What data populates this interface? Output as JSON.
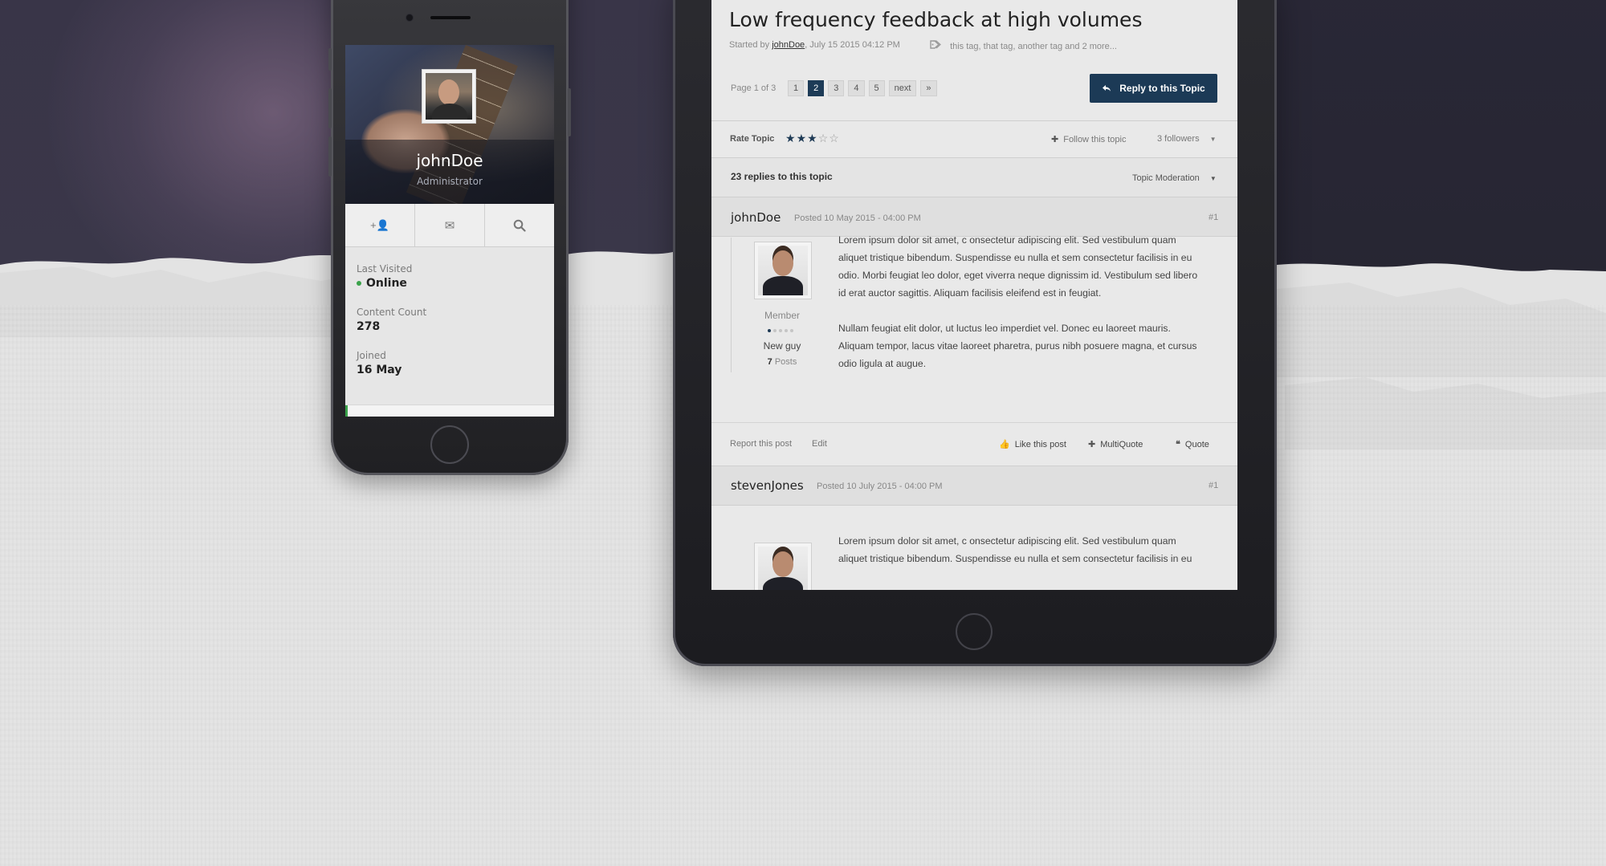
{
  "phone": {
    "profile": {
      "username": "johnDoe",
      "role": "Administrator",
      "actions": [
        {
          "icon": "add-user-icon",
          "glyph": "+👤"
        },
        {
          "icon": "envelope-icon",
          "glyph": "✉"
        },
        {
          "icon": "search-icon",
          "glyph": "⌕"
        }
      ],
      "stats": {
        "last_visited_label": "Last Visited",
        "last_visited_value": "Online",
        "content_count_label": "Content Count",
        "content_count_value": "278",
        "joined_label": "Joined",
        "joined_value": "16 May"
      }
    }
  },
  "topic": {
    "title": "Low frequency feedback at high volumes",
    "started_by_prefix": "Started by ",
    "author": "johnDoe",
    "started_date": ", July 15 2015 04:12 PM",
    "tags": "this tag, that tag, another tag and 2 more...",
    "pagination": {
      "label": "Page 1 of 3",
      "pages": [
        "1",
        "2",
        "3",
        "4",
        "5"
      ],
      "active_page": "2",
      "next_label": "next",
      "last_label": "»"
    },
    "reply_button": "Reply to this Topic",
    "rate_label": "Rate Topic",
    "rating": 3,
    "rating_max": 5,
    "follow_label": "Follow this topic",
    "followers_label": "3 followers",
    "replies_label": "23 replies to this topic",
    "moderation_label": "Topic Moderation"
  },
  "posts": [
    {
      "author": "johnDoe",
      "date": "Posted 10 May 2015 - 04:00 PM",
      "number": "#1",
      "member_group": "Member",
      "rank_level": 1,
      "rank_max": 5,
      "rank_title": "New guy",
      "post_count": "7",
      "post_count_suffix": " Posts",
      "paragraphs": [
        "Lorem ipsum dolor sit amet, c onsectetur adipiscing elit. Sed vestibulum quam aliquet tristique bibendum. Suspendisse eu nulla et sem consectetur facilisis in eu odio. Morbi feugiat leo dolor, eget viverra neque dignissim id. Vestibulum sed libero id erat auctor sagittis. Aliquam facilisis eleifend est in feugiat.",
        "Nullam feugiat elit dolor, ut luctus leo imperdiet vel. Donec eu laoreet mauris. Aliquam tempor, lacus vitae laoreet pharetra, purus nibh posuere magna, et cursus odio ligula at augue."
      ],
      "footer": {
        "report": "Report this post",
        "edit": "Edit",
        "like": "Like this post",
        "multiquote": "MultiQuote",
        "quote": "Quote"
      }
    },
    {
      "author": "stevenJones",
      "date": "Posted 10 July 2015 - 04:00 PM",
      "number": "#1",
      "paragraphs": [
        "Lorem ipsum dolor sit amet, c onsectetur adipiscing elit. Sed vestibulum quam aliquet tristique bibendum. Suspendisse eu nulla et sem consectetur facilisis in eu"
      ]
    }
  ],
  "colors": {
    "accent": "#1c3a56",
    "online": "#3aa24a",
    "background_dark": "#393548",
    "paper": "#e3e3e3"
  }
}
